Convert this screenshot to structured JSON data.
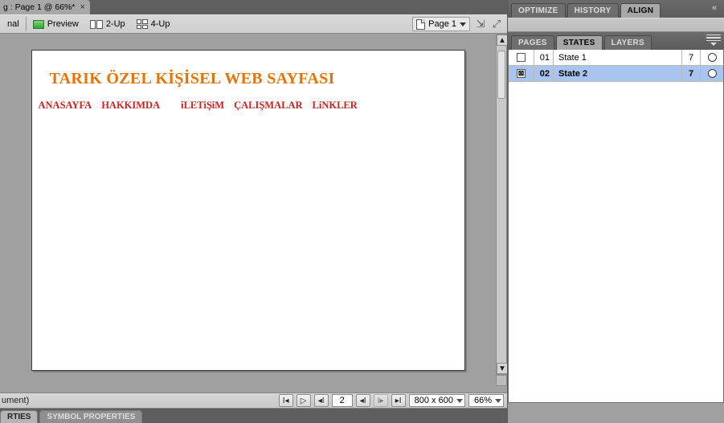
{
  "doc_tab": {
    "title": "g : Page 1 @ 66%* ",
    "close": "×"
  },
  "view_bar": {
    "original": "nal",
    "preview": "Preview",
    "two_up": "2-Up",
    "four_up": "4-Up",
    "page_selector": "Page 1"
  },
  "page_content": {
    "heading": "TARIK ÖZEL KİŞİSEL WEB SAYFASI",
    "nav": {
      "anasayfa": "ANASAYFA",
      "hakkimda": "HAKKIMDA",
      "iletisim": "iLETiŞiM",
      "calismalar": "ÇALIŞMALAR",
      "linkler": "LiNKLER"
    }
  },
  "status": {
    "left": "ument)",
    "frame_index": "2",
    "dimensions": "800 x 600",
    "zoom": "66%"
  },
  "prop_tabs": {
    "rties": "RTIES",
    "symbol": "SYMBOL PROPERTIES"
  },
  "top_panel_tabs": {
    "optimize": "OPTIMIZE",
    "history": "HISTORY",
    "align": "ALIGN"
  },
  "mid_panel_tabs": {
    "pages": "PAGES",
    "states": "STATES",
    "layers": "LAYERS"
  },
  "states": [
    {
      "checked": false,
      "idx": "01",
      "name": "State 1",
      "num": "7",
      "selected": false
    },
    {
      "checked": true,
      "idx": "02",
      "name": "State 2",
      "num": "7",
      "selected": true
    }
  ]
}
